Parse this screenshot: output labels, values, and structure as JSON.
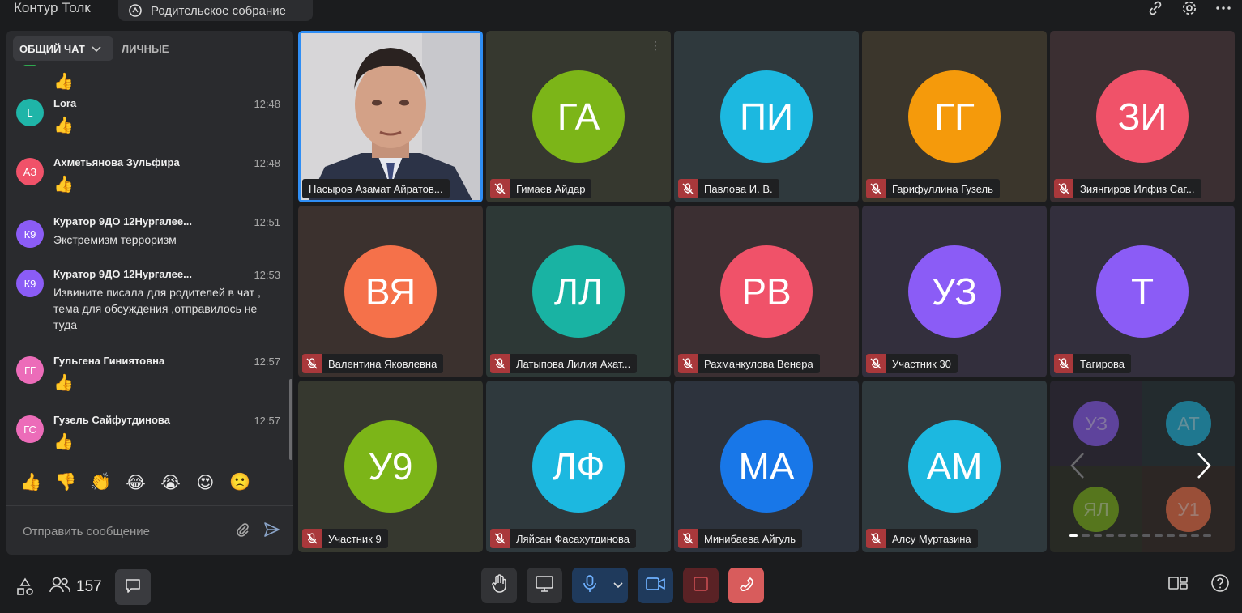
{
  "app": {
    "title": "Контур Толк"
  },
  "meeting": {
    "title": "Родительское собрание"
  },
  "chat": {
    "tabs": {
      "general": "ОБЩИЙ ЧАТ",
      "personal": "ЛИЧНЫЕ"
    },
    "messages": [
      {
        "initials": "",
        "name": "",
        "time": "",
        "text": "",
        "emoji": "👍",
        "color": "#2fa84f"
      },
      {
        "initials": "L",
        "name": "Lora",
        "time": "12:48",
        "text": "",
        "emoji": "👍",
        "color": "#1fb5a8"
      },
      {
        "initials": "АЗ",
        "name": "Ахметьянова Зульфира",
        "time": "12:48",
        "text": "",
        "emoji": "👍",
        "color": "#f05269"
      },
      {
        "initials": "К9",
        "name": "Куратор 9ДО 12Нургалее...",
        "time": "12:51",
        "text": "Экстремизм терроризм",
        "emoji": "",
        "color": "#8b5cf6"
      },
      {
        "initials": "К9",
        "name": "Куратор 9ДО 12Нургалее...",
        "time": "12:53",
        "text": "Извините писала для родителей в чат , тема для обсуждения ,отправилось не туда",
        "emoji": "",
        "color": "#8b5cf6"
      },
      {
        "initials": "ГГ",
        "name": "Гульгена Гиниятовна",
        "time": "12:57",
        "text": "",
        "emoji": "👍",
        "color": "#ec6cb9"
      },
      {
        "initials": "ГС",
        "name": "Гузель Сайфутдинова",
        "time": "12:57",
        "text": "",
        "emoji": "👍",
        "color": "#ec6cb9"
      }
    ],
    "reactions": [
      "👍",
      "👎",
      "👏",
      "😂",
      "😭",
      "😍",
      "🙁"
    ],
    "composer": {
      "placeholder": "Отправить сообщение"
    }
  },
  "tiles": [
    {
      "name": "Насыров Азамат Айратов...",
      "initials": "",
      "color": "",
      "bg": "#3a3c40",
      "video": true
    },
    {
      "name": "Гимаев Айдар",
      "initials": "ГА",
      "color": "#7cb518",
      "bg": "#36382f"
    },
    {
      "name": "Павлова И. В.",
      "initials": "ПИ",
      "color": "#1cb8e0",
      "bg": "#2f393d"
    },
    {
      "name": "Гарифуллина Гузель",
      "initials": "ГГ",
      "color": "#f59a0b",
      "bg": "#3b362c"
    },
    {
      "name": "Зиянгиров Илфиз Саг...",
      "initials": "ЗИ",
      "color": "#f05269",
      "bg": "#3b2f32"
    },
    {
      "name": "Валентина Яковлевна",
      "initials": "ВЯ",
      "color": "#f5714a",
      "bg": "#3b312e"
    },
    {
      "name": "Латыпова Лилия Ахат...",
      "initials": "ЛЛ",
      "color": "#19b3a3",
      "bg": "#2d3836"
    },
    {
      "name": "Рахманкулова Венера",
      "initials": "РВ",
      "color": "#f05269",
      "bg": "#3b2f32"
    },
    {
      "name": "Участник 30",
      "initials": "УЗ",
      "color": "#8b5cf6",
      "bg": "#332f3d"
    },
    {
      "name": "Тагирова",
      "initials": "Т",
      "color": "#8b5cf6",
      "bg": "#332f3d"
    },
    {
      "name": "Участник 9",
      "initials": "У9",
      "color": "#7cb518",
      "bg": "#36382f"
    },
    {
      "name": "Ляйсан Фасахутдинова",
      "initials": "ЛФ",
      "color": "#1cb8e0",
      "bg": "#2f393d"
    },
    {
      "name": "Минибаева Айгуль",
      "initials": "МА",
      "color": "#1877e8",
      "bg": "#2d333d"
    },
    {
      "name": "Алсу Муртазина",
      "initials": "АМ",
      "color": "#1cb8e0",
      "bg": "#2f393d"
    }
  ],
  "mini_grid": [
    {
      "initials": "УЗ",
      "color": "#8b5cf6",
      "bg": "#28252f"
    },
    {
      "initials": "АТ",
      "color": "#1cb8e0",
      "bg": "#232b2e"
    },
    {
      "initials": "ЯЛ",
      "color": "#7cb518",
      "bg": "#282a24"
    },
    {
      "initials": "У1",
      "color": "#f5714a",
      "bg": "#2c2624"
    }
  ],
  "bottom": {
    "participants_count": "157"
  }
}
